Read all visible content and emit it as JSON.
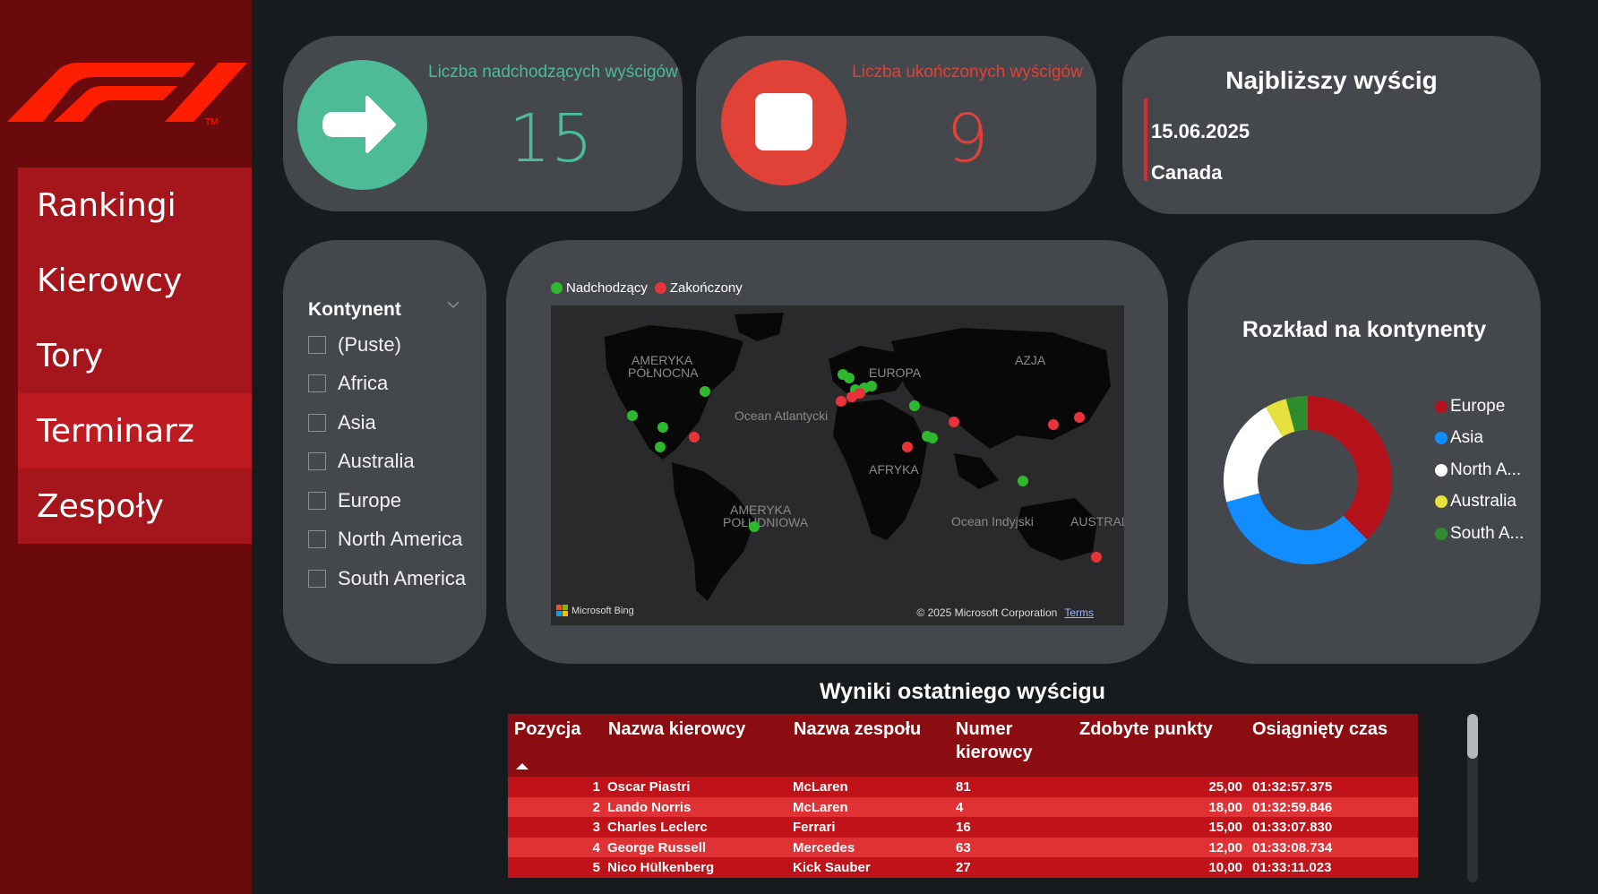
{
  "sidebar": {
    "logo_name": "f1-logo",
    "items": [
      {
        "label": "Rankingi",
        "active": false
      },
      {
        "label": "Kierowcy",
        "active": false
      },
      {
        "label": "Tory",
        "active": false
      },
      {
        "label": "Terminarz",
        "active": true
      },
      {
        "label": "Zespoły",
        "active": false
      }
    ]
  },
  "kpi_upcoming": {
    "label": "Liczba nadchodzących wyścigów",
    "value": "15",
    "color": "#4dbb96",
    "icon": "arrow-right-icon"
  },
  "kpi_finished": {
    "label": "Liczba ukończonych wyścigów",
    "value": "9",
    "color": "#e04238",
    "icon": "stop-icon"
  },
  "next_race": {
    "title": "Najbliższy wyścig",
    "date": "15.06.2025",
    "location": "Canada"
  },
  "slicer": {
    "title": "Kontynent",
    "options": [
      "(Puste)",
      "Africa",
      "Asia",
      "Australia",
      "Europe",
      "North America",
      "South America"
    ]
  },
  "map": {
    "legend": [
      {
        "label": "Nadchodzący",
        "color": "#2eb82e"
      },
      {
        "label": "Zakończony",
        "color": "#e8333a"
      }
    ],
    "labels": {
      "north_america_1": "AMERYKA",
      "north_america_2": "PÓŁNOCNA",
      "europe": "EUROPA",
      "asia": "AZJA",
      "atlantic": "Ocean Atlantycki",
      "africa": "AFRYKA",
      "south_america_1": "AMERYKA",
      "south_america_2": "POŁUDNIOWA",
      "indian": "Ocean Indyjski",
      "australia": "AUSTRAL"
    },
    "attribution": "Microsoft Bing",
    "copyright": "© 2025 Microsoft Corporation",
    "terms": "Terms"
  },
  "donut": {
    "title": "Rozkład na kontynenty",
    "legend": [
      {
        "label": "Europe",
        "color": "#b5121b"
      },
      {
        "label": "Asia",
        "color": "#118dff"
      },
      {
        "label": "North A...",
        "color": "#ffffff"
      },
      {
        "label": "Australia",
        "color": "#e6e13c"
      },
      {
        "label": "South A...",
        "color": "#2e8b2e"
      }
    ]
  },
  "chart_data": {
    "type": "pie",
    "title": "Rozkład na kontynenty",
    "categories": [
      "Europe",
      "Asia",
      "North America",
      "Australia",
      "South America"
    ],
    "values": [
      9,
      8,
      5,
      1,
      1
    ],
    "legend": "right"
  },
  "results": {
    "title": "Wyniki ostatniego wyścigu",
    "columns": [
      "Pozycja",
      "Nazwa kierowcy",
      "Nazwa zespołu",
      "Numer kierowcy",
      "Zdobyte punkty",
      "Osiągnięty czas"
    ],
    "rows": [
      {
        "pos": "1",
        "driver": "Oscar Piastri",
        "team": "McLaren",
        "number": "81",
        "points": "25,00",
        "time": "01:32:57.375"
      },
      {
        "pos": "2",
        "driver": "Lando Norris",
        "team": "McLaren",
        "number": "4",
        "points": "18,00",
        "time": "01:32:59.846"
      },
      {
        "pos": "3",
        "driver": "Charles Leclerc",
        "team": "Ferrari",
        "number": "16",
        "points": "15,00",
        "time": "01:33:07.830"
      },
      {
        "pos": "4",
        "driver": "George Russell",
        "team": "Mercedes",
        "number": "63",
        "points": "12,00",
        "time": "01:33:08.734"
      },
      {
        "pos": "5",
        "driver": "Nico Hülkenberg",
        "team": "Kick Sauber",
        "number": "27",
        "points": "10,00",
        "time": "01:33:11.023"
      }
    ]
  }
}
